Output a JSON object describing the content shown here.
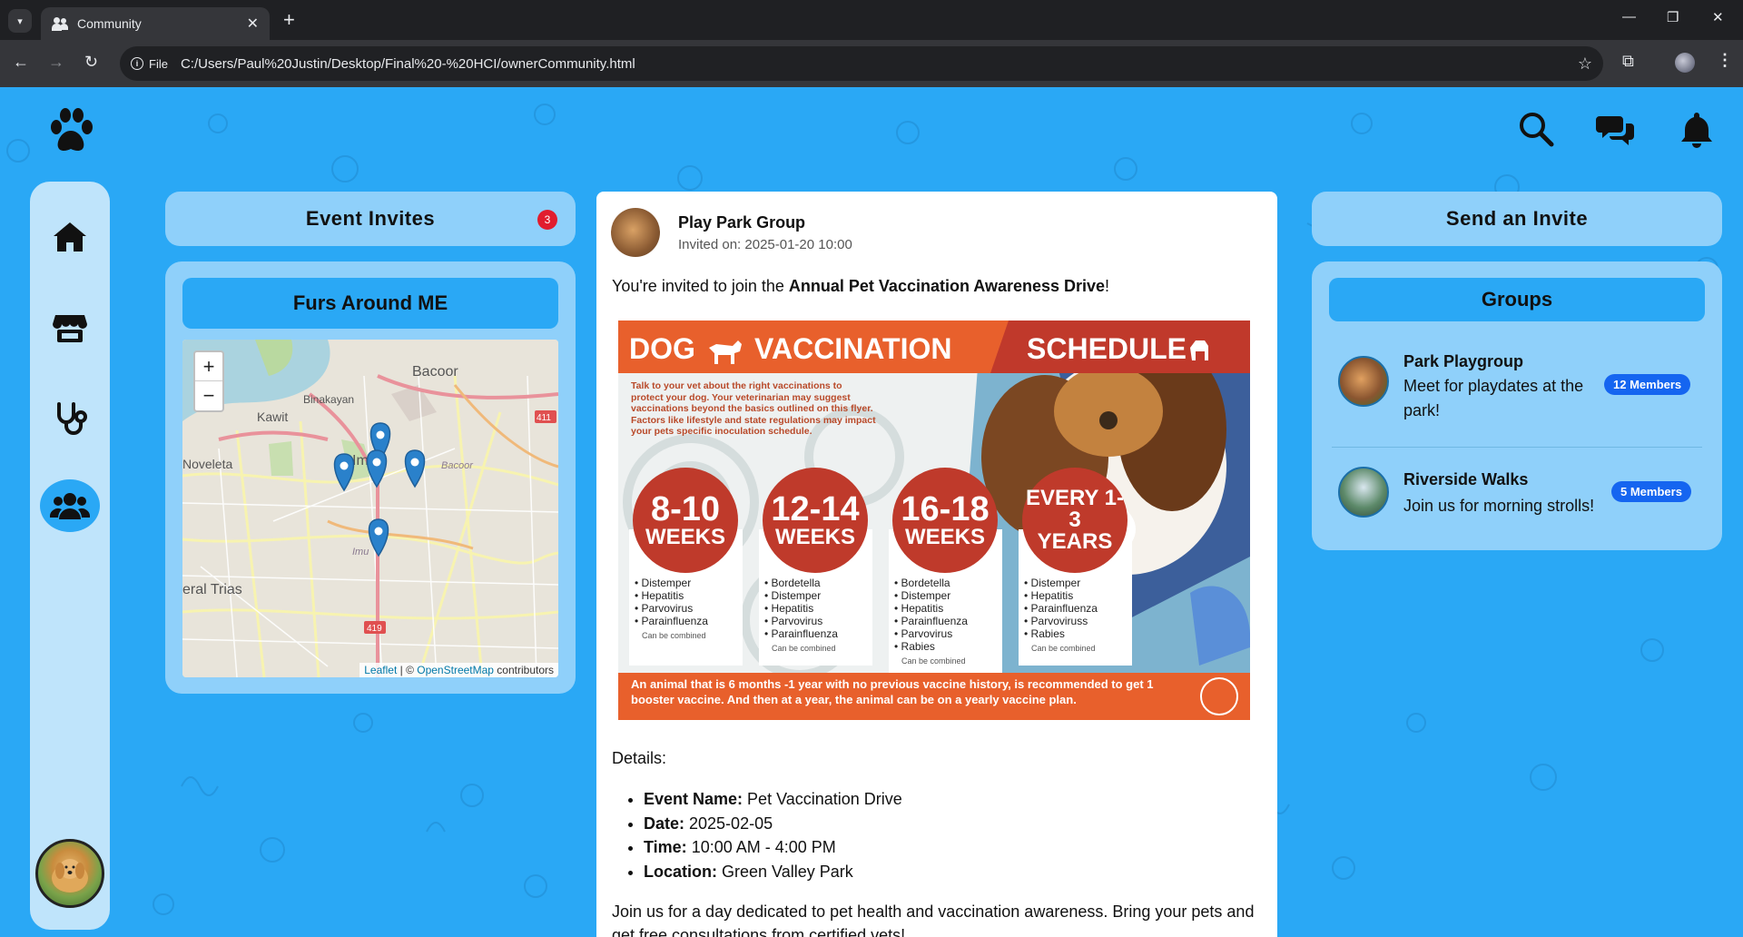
{
  "browser": {
    "tab_title": "Community",
    "file_chip": "File",
    "url": "C:/Users/Paul%20Justin/Desktop/Final%20-%20HCI/ownerCommunity.html"
  },
  "header": {
    "icons": [
      "paw-icon",
      "search-icon",
      "chat-icon",
      "bell-icon"
    ]
  },
  "sidebar": {
    "items": [
      {
        "name": "home",
        "icon": "home-icon"
      },
      {
        "name": "store",
        "icon": "store-icon"
      },
      {
        "name": "vet",
        "icon": "stethoscope-icon"
      },
      {
        "name": "community",
        "icon": "users-icon",
        "active": true
      }
    ]
  },
  "event_invites": {
    "title": "Event Invites",
    "badge": "3"
  },
  "furs_around": {
    "title": "Furs Around ME",
    "map": {
      "labels": [
        "Bacoor",
        "Binakayan",
        "Kawit",
        "Noveleta",
        "Im",
        "Bacoor",
        "Imu",
        "eral Trias"
      ],
      "road_shields": [
        "411",
        "419"
      ],
      "zoom_in": "+",
      "zoom_out": "−",
      "attribution": {
        "leaflet": "Leaflet",
        "sep": " | © ",
        "osm": "OpenStreetMap",
        "tail": " contributors"
      }
    }
  },
  "post": {
    "group": "Play Park Group",
    "invited_on": "Invited on: 2025-01-20 10:00",
    "intro_prefix": "You're invited to join the ",
    "intro_event": "Annual Pet Vaccination Awareness Drive",
    "intro_suffix": "!",
    "flyer": {
      "title_left": "DOG",
      "title_mid": "VACCINATION",
      "title_right": "SCHEDULE",
      "blurb": "Talk to your vet about the right vaccinations to protect your dog. Your veterinarian may suggest vaccinations beyond the basics outlined on this flyer. Factors like lifestyle and state regulations may impact your pets specific inoculation schedule.",
      "stages": [
        {
          "top": "8-10",
          "bottom": "WEEKS",
          "items": [
            "Distemper",
            "Hepatitis",
            "Parvovirus",
            "Parainfluenza"
          ],
          "note": "Can be combined"
        },
        {
          "top": "12-14",
          "bottom": "WEEKS",
          "items": [
            "Bordetella",
            "Distemper",
            "Hepatitis",
            "Parvovirus",
            "Parainfluenza"
          ],
          "note": "Can be combined"
        },
        {
          "top": "16-18",
          "bottom": "WEEKS",
          "items": [
            "Bordetella",
            "Distemper",
            "Hepatitis",
            "Parainfluenza",
            "Parvovirus",
            "Rabies"
          ],
          "note": "Can be combined"
        },
        {
          "top": "EVERY 1-3",
          "bottom": "YEARS",
          "items": [
            "Distemper",
            "Hepatitis",
            "Parainfluenza",
            "Parvoviruss",
            "Rabies"
          ],
          "note": "Can be combined"
        }
      ],
      "footer": "An animal that is 6 months -1 year with no previous vaccine history, is recommended to get 1 booster vaccine. And then at a year, the animal can be on a yearly vaccine plan."
    },
    "details_label": "Details:",
    "details": [
      {
        "label": "Event Name:",
        "value": " Pet Vaccination Drive"
      },
      {
        "label": "Date:",
        "value": " 2025-02-05"
      },
      {
        "label": "Time:",
        "value": " 10:00 AM - 4:00 PM"
      },
      {
        "label": "Location:",
        "value": " Green Valley Park"
      }
    ],
    "body": "Join us for a day dedicated to pet health and vaccination awareness. Bring your pets and get free consultations from certified vets!"
  },
  "send_invite": {
    "title": "Send an Invite"
  },
  "groups": {
    "title": "Groups",
    "items": [
      {
        "name": "Park Playgroup",
        "desc": "Meet for playdates at the park!",
        "members": "12 Members"
      },
      {
        "name": "Riverside Walks",
        "desc": "Join us for morning strolls!",
        "members": "5 Members"
      }
    ]
  },
  "colors": {
    "page_bg": "#2aa8f5",
    "panel": "#8fd0fa",
    "badge_red": "#e11d2e",
    "members_blue": "#1565f0",
    "flyer_orange": "#e8602c"
  }
}
